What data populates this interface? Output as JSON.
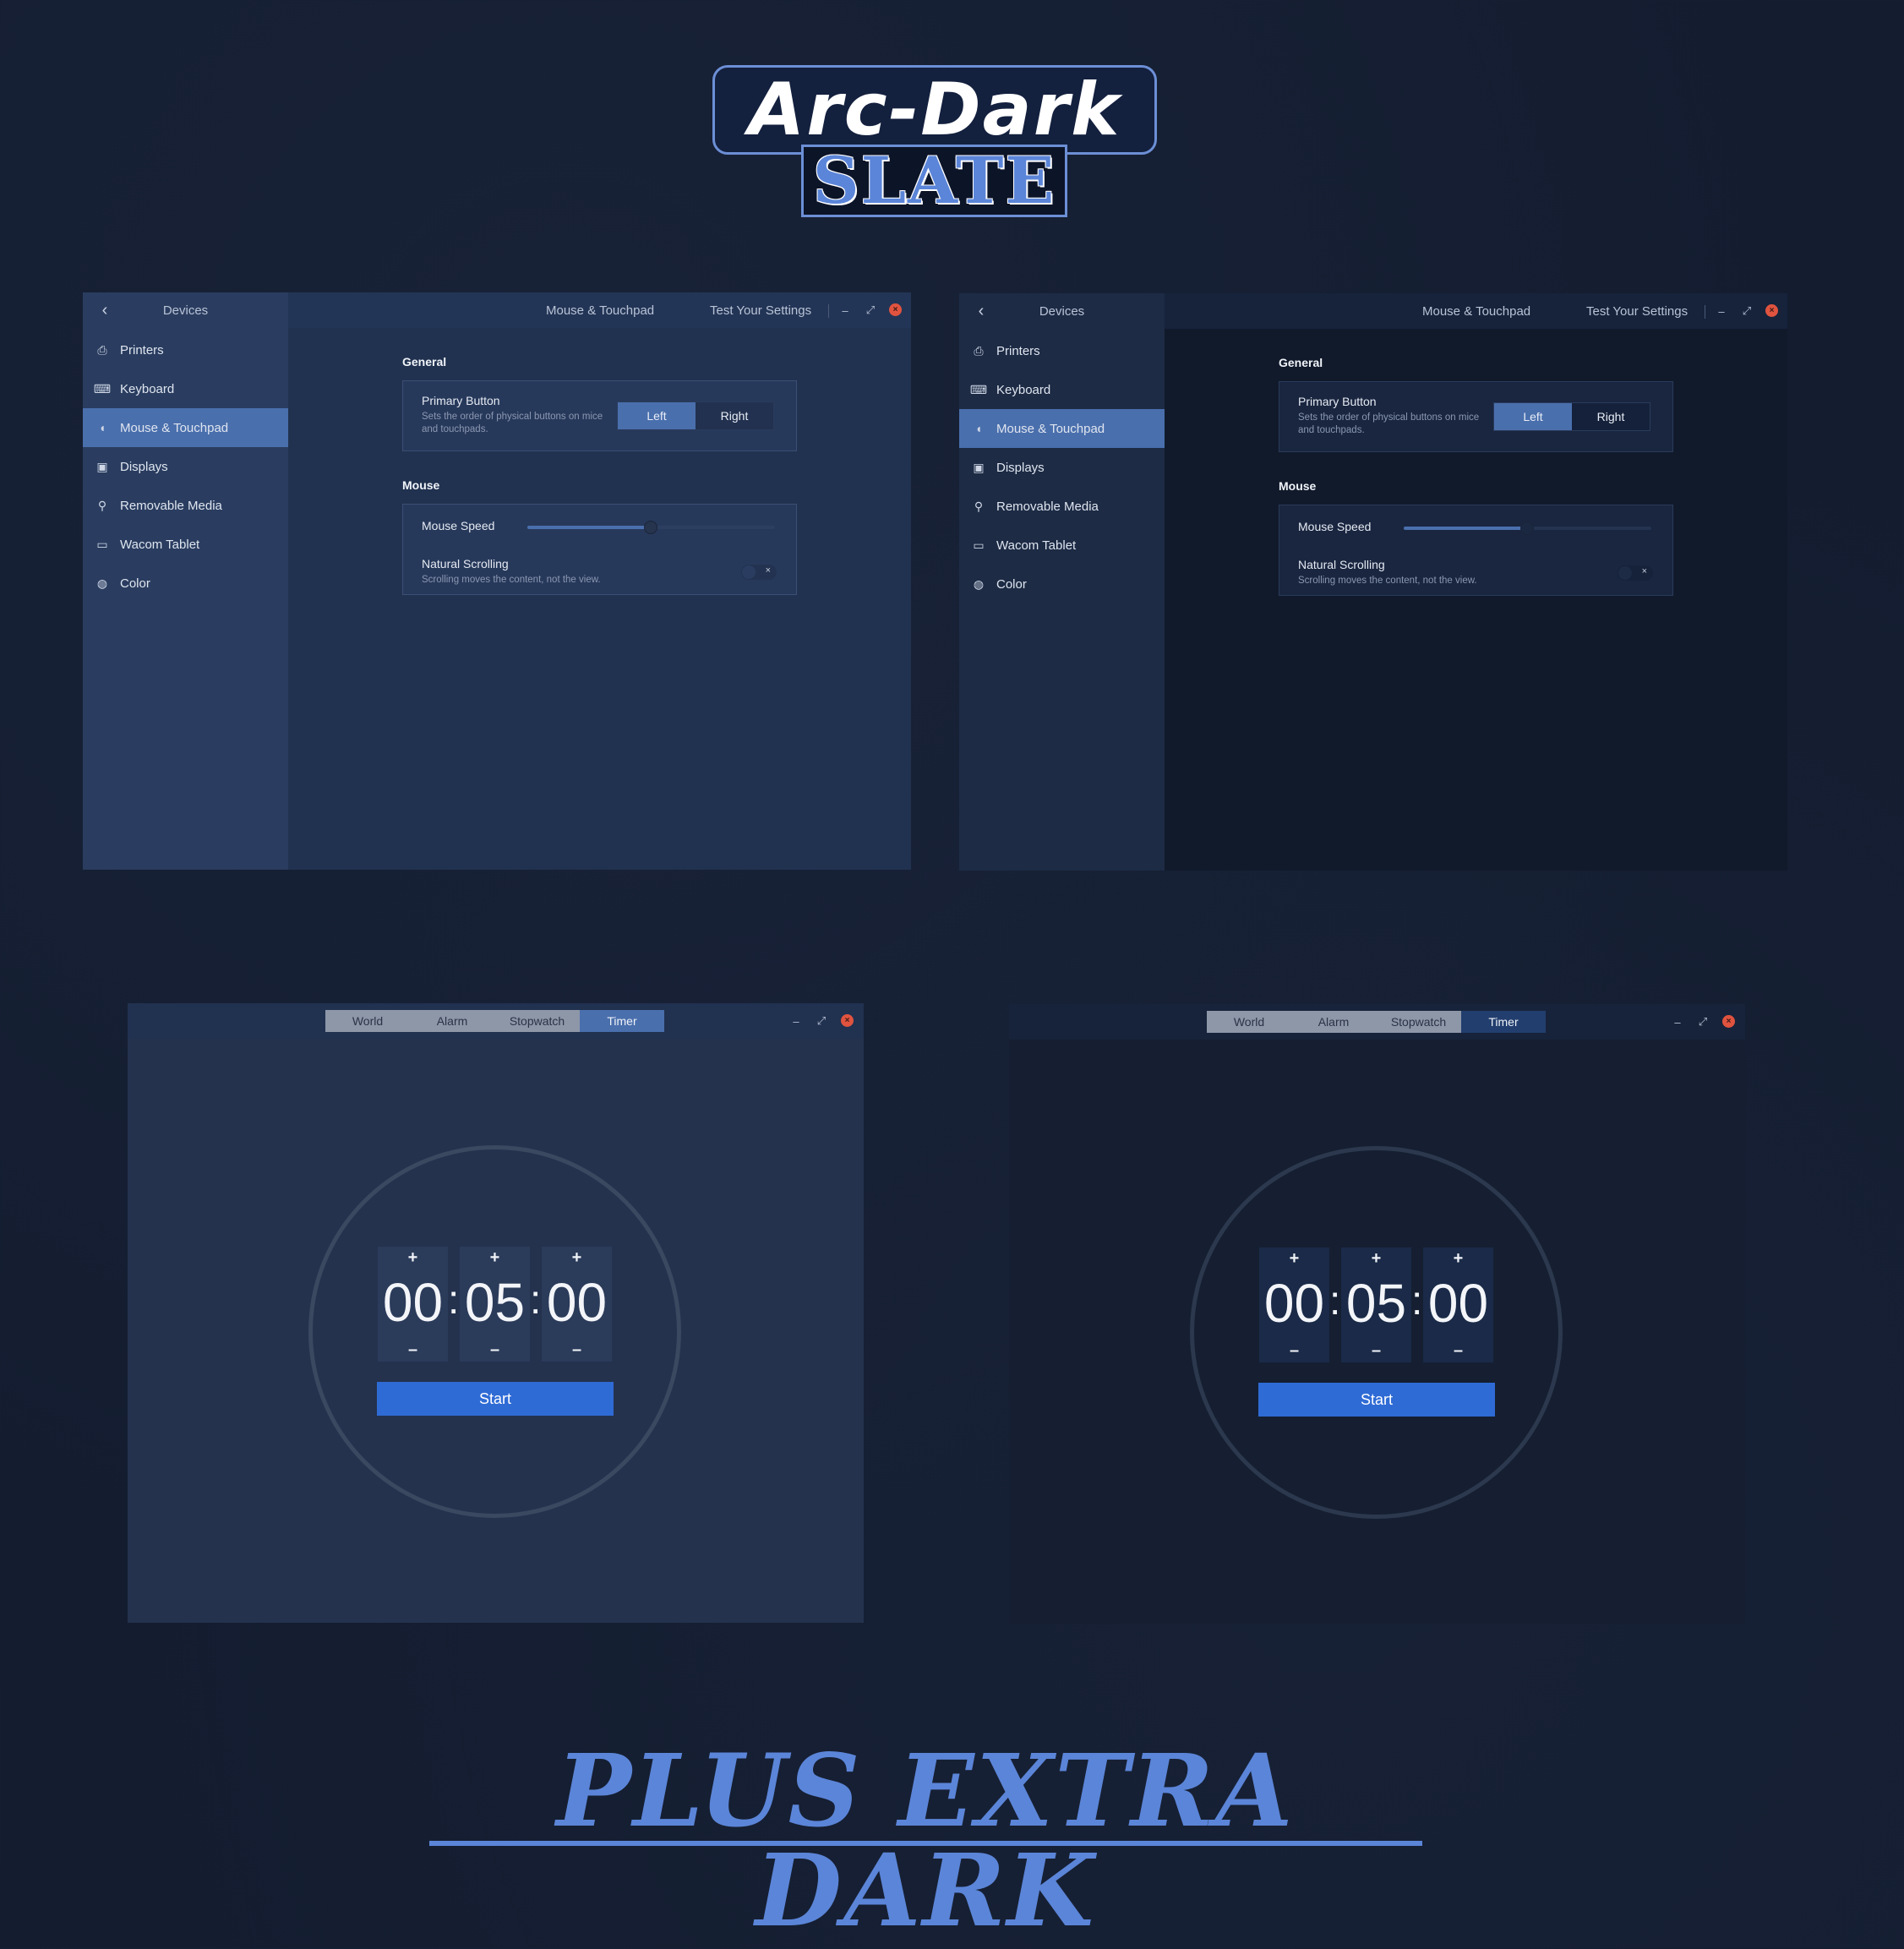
{
  "logo": {
    "line1": "Arc-Dark",
    "line2": "SLATE"
  },
  "tagline": "PLUS EXTRA DARK",
  "settings": {
    "sidebar_title": "Devices",
    "window_title": "Mouse & Touchpad",
    "test_button": "Test Your Settings",
    "items": [
      {
        "label": "Printers",
        "icon": "printer-icon"
      },
      {
        "label": "Keyboard",
        "icon": "keyboard-icon"
      },
      {
        "label": "Mouse & Touchpad",
        "icon": "mouse-icon"
      },
      {
        "label": "Displays",
        "icon": "display-icon"
      },
      {
        "label": "Removable Media",
        "icon": "usb-icon"
      },
      {
        "label": "Wacom Tablet",
        "icon": "tablet-icon"
      },
      {
        "label": "Color",
        "icon": "color-icon"
      }
    ],
    "active_item": "Mouse & Touchpad",
    "general_label": "General",
    "primary_button_title": "Primary Button",
    "primary_button_desc": "Sets the order of physical buttons on mice and touchpads.",
    "primary_left": "Left",
    "primary_right": "Right",
    "primary_selected": "Left",
    "mouse_label": "Mouse",
    "mouse_speed_label": "Mouse Speed",
    "mouse_speed_value": 0.5,
    "natural_scrolling_title": "Natural Scrolling",
    "natural_scrolling_desc": "Scrolling moves the content, not the view.",
    "natural_scrolling_on": false,
    "toggle_off_glyph": "×",
    "minimize_glyph": "–",
    "maximize_glyph": "⤢",
    "close_glyph": "×",
    "back_glyph": "‹"
  },
  "clock": {
    "tabs": [
      "World",
      "Alarm",
      "Stopwatch",
      "Timer"
    ],
    "active_tab": "Timer",
    "hours": "00",
    "minutes": "05",
    "seconds": "00",
    "separator": ":",
    "plus": "+",
    "minus": "–",
    "start_label": "Start"
  },
  "colors": {
    "accent": "#4a6fad",
    "start_button": "#2f6bd5",
    "close_button": "#e0533f",
    "logo_blue": "#5b85d8"
  }
}
